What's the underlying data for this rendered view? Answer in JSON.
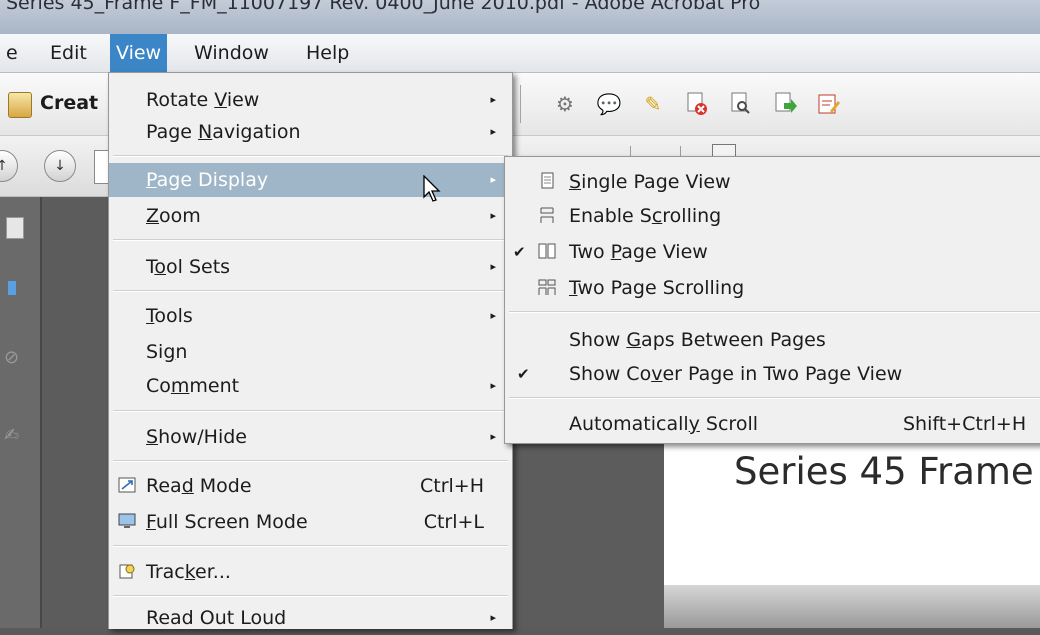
{
  "window": {
    "title": "Series 45_Frame F_FM_11007197 Rev. 0400_June 2010.pdf - Adobe Acrobat Pro"
  },
  "menubar": {
    "items": [
      {
        "label": "e"
      },
      {
        "label": "Edit"
      },
      {
        "label": "View"
      },
      {
        "label": "Window"
      },
      {
        "label": "Help"
      }
    ]
  },
  "toolbar": {
    "create_label": "Creat",
    "icons": [
      "gear-icon",
      "comment-bubble-icon",
      "highlight-pen-icon",
      "delete-page-icon",
      "search-page-icon",
      "export-page-icon",
      "sign-edit-icon"
    ]
  },
  "view_menu": {
    "items": [
      {
        "pre": "Rotate ",
        "u": "V",
        "post": "iew",
        "arrow": "▸"
      },
      {
        "pre": "Page ",
        "u": "N",
        "post": "avigation",
        "arrow": "▸"
      },
      {
        "pre": "",
        "u": "P",
        "post": "age Display",
        "arrow": "▸"
      },
      {
        "pre": "",
        "u": "Z",
        "post": "oom",
        "arrow": "▸"
      },
      {
        "pre": "T",
        "u": "o",
        "post": "ol Sets",
        "arrow": "▸"
      },
      {
        "pre": "",
        "u": "T",
        "post": "ools",
        "arrow": "▸"
      },
      {
        "pre": "Si",
        "u": "g",
        "post": "n"
      },
      {
        "pre": "Co",
        "u": "m",
        "post": "ment",
        "arrow": "▸"
      },
      {
        "pre": "",
        "u": "S",
        "post": "how/Hide",
        "arrow": "▸"
      },
      {
        "pre": "Rea",
        "u": "d",
        "post": " Mode",
        "shortcut": "Ctrl+H"
      },
      {
        "pre": "",
        "u": "F",
        "post": "ull Screen Mode",
        "shortcut": "Ctrl+L"
      },
      {
        "pre": "Trac",
        "u": "k",
        "post": "er..."
      },
      {
        "pre": "Read Out Loud",
        "u": "",
        "post": "",
        "arrow": "▸"
      }
    ]
  },
  "page_display_submenu": {
    "items": [
      {
        "pre": "",
        "u": "S",
        "post": "ingle Page View",
        "checked": false
      },
      {
        "pre": "Enable S",
        "u": "c",
        "post": "rolling",
        "checked": false
      },
      {
        "pre": "Two ",
        "u": "P",
        "post": "age View",
        "checked": true
      },
      {
        "pre": "",
        "u": "T",
        "post": "wo Page Scrolling",
        "checked": false
      },
      {
        "pre": "Show ",
        "u": "G",
        "post": "aps Between Pages",
        "checked": false
      },
      {
        "pre": "Show Co",
        "u": "v",
        "post": "er Page in Two Page View",
        "checked": true
      },
      {
        "pre": "Automaticall",
        "u": "y",
        "post": " Scroll",
        "shortcut": "Shift+Ctrl+H",
        "checked": false
      }
    ],
    "check_glyph": "✔"
  },
  "document": {
    "heading": "Series 45 Frame"
  },
  "colors": {
    "menu_active": "#3b86c6",
    "item_highlight": "#9fb6c9"
  }
}
